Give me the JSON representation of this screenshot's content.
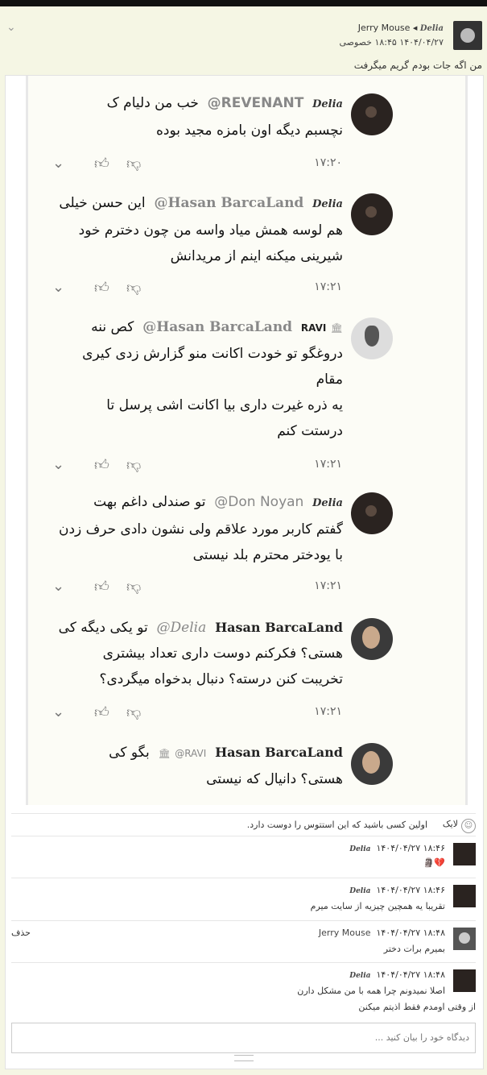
{
  "header": {
    "author_name": "Jerry Mouse",
    "tagged_user": "Delia",
    "datetime": "۱۴۰۴/۰۴/۲۷ ۱۸:۴۵",
    "privacy": "خصوصی",
    "status_text": "من اگه جات بودم گریم میگرفت"
  },
  "screenshot_comments": [
    {
      "author": "Delia",
      "mention": "@REVENANT",
      "lines": [
        "خب من دلیام ک",
        "نچسبم دیگه اون بامزه مجید بوده"
      ],
      "time": "۱۷:۲۰"
    },
    {
      "author": "Delia",
      "mention": "@Hasan BarcaLand",
      "lines": [
        "این حسن خیلی",
        "هم لوسه همش میاد واسه من چون دخترم خود",
        "شیرینی میکنه اینم از مریدانش"
      ],
      "time": "۱۷:۲۱"
    },
    {
      "author": "RAVI",
      "mention": "@Hasan BarcaLand",
      "lines": [
        "کص ننه",
        "دروغگو تو خودت اکانت منو گزارش زدی کیری",
        "مقام",
        "یه ذره غیرت داری بیا اکانت اشی پرسل تا",
        "درستت کنم"
      ],
      "time": "۱۷:۲۱"
    },
    {
      "author": "Delia",
      "mention": "@Don Noyan",
      "lines": [
        "تو صندلی داغم بهت",
        "گفتم کاربر مورد علاقم ولی نشون دادی حرف زدن",
        "با یودختر محترم بلد نیستی"
      ],
      "time": "۱۷:۲۱"
    },
    {
      "author": "Hasan BarcaLand",
      "mention": "@Delia",
      "lines": [
        "تو یکی دیگه کی",
        "هستی؟ فکرکنم دوست داری تعداد بیشتری",
        "تخریبت کنن درسته؟ دنبال بدخواه میگردی؟"
      ],
      "time": "۱۷:۲۱"
    },
    {
      "author": "Hasan BarcaLand",
      "mention": "@RAVI",
      "lines": [
        "بگو کی",
        "هستی؟ دانیال که نیستی"
      ],
      "time": ""
    }
  ],
  "likes": {
    "label": "لایک",
    "text": "اولین کسی باشید که این استتوس را دوست دارد."
  },
  "replies": [
    {
      "author": "Delia",
      "datetime": "۱۴۰۴/۰۴/۲۷ ۱۸:۴۶",
      "lines": [
        "💔🗿"
      ]
    },
    {
      "author": "Delia",
      "datetime": "۱۴۰۴/۰۴/۲۷ ۱۸:۴۶",
      "lines": [
        "تقریبا یه همچین چیزیه از سایت میرم"
      ]
    },
    {
      "author": "Jerry Mouse",
      "datetime": "۱۴۰۴/۰۴/۲۷ ۱۸:۴۸",
      "lines": [
        "بمیرم برات دختر"
      ],
      "delete_label": "حذف"
    },
    {
      "author": "Delia",
      "datetime": "۱۴۰۴/۰۴/۲۷ ۱۸:۴۸",
      "lines": [
        "اصلا نمیدونم چرا همه با من مشکل دارن",
        "از وقتی اومدم فقط اذیتم میکنن"
      ]
    }
  ],
  "comment_box": {
    "placeholder": "دیدگاه خود را بیان کنید ..."
  }
}
